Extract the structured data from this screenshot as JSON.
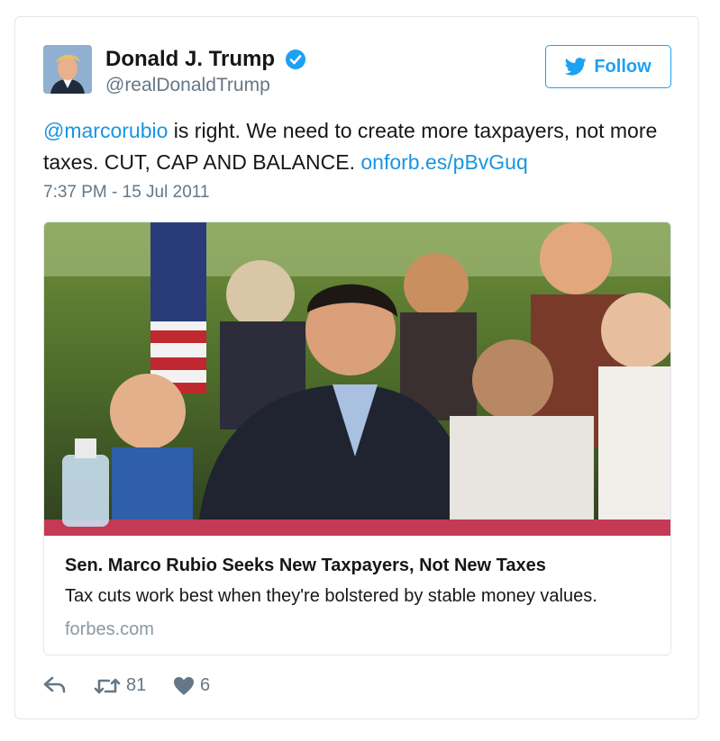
{
  "author": {
    "name": "Donald J. Trump",
    "handle": "@realDonaldTrump"
  },
  "follow_button": {
    "label": "Follow",
    "icon": "twitter-bird-icon"
  },
  "tweet": {
    "mention": "@marcorubio",
    "text_part": " is right. We need to create more taxpayers, not more taxes. CUT, CAP AND BALANCE. ",
    "link": "onforb.es/pBvGuq",
    "timestamp": "7:37 PM - 15 Jul 2011"
  },
  "card": {
    "title": "Sen. Marco Rubio Seeks New Taxpayers, Not New Taxes",
    "description": "Tax cuts work best when they're bolstered by stable money values.",
    "domain": "forbes.com"
  },
  "actions": {
    "reply_icon": "reply-icon",
    "retweet_icon": "retweet-icon",
    "retweet_count": "81",
    "like_icon": "heart-icon",
    "like_count": "6"
  },
  "colors": {
    "accent": "#1da1f2",
    "link": "#1b95e0",
    "muted": "#657786",
    "border": "#e1e8ed"
  }
}
